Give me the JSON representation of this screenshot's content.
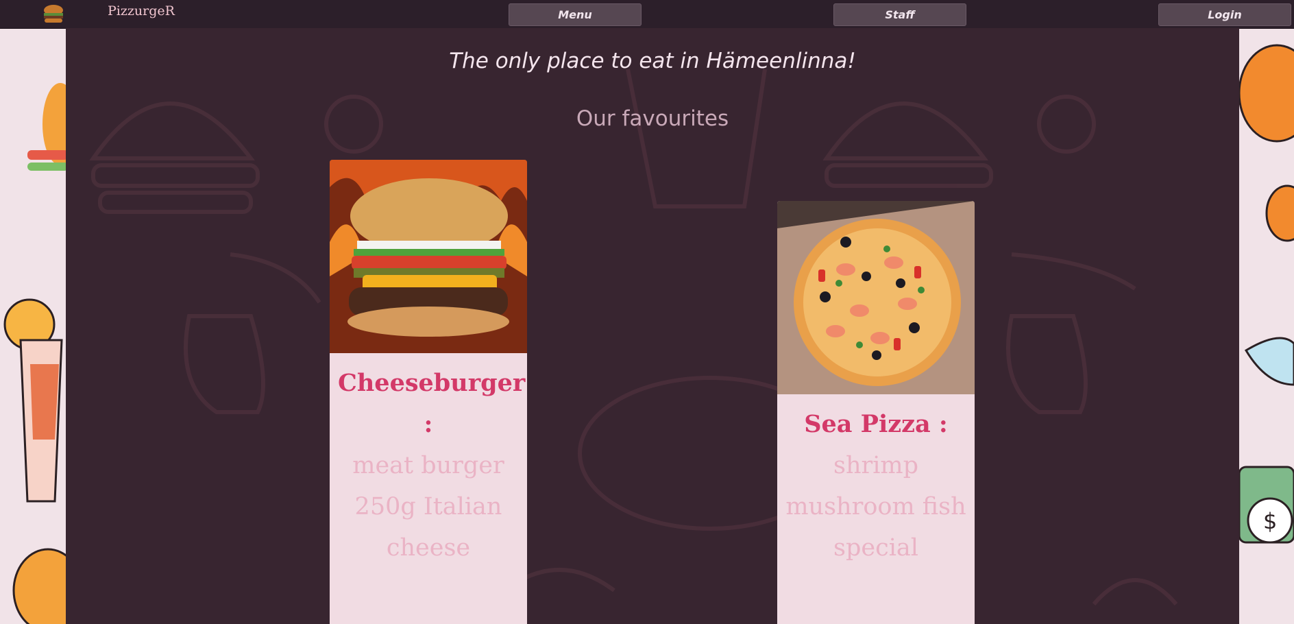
{
  "app": {
    "brand": "PizzurgeR",
    "logo_icon": "burger-logo-icon"
  },
  "nav": {
    "menu_label": "Menu",
    "staff_label": "Staff",
    "login_label": "Login"
  },
  "hero": {
    "tagline": "The only place to eat in Hämeenlinna!",
    "section_title": "Our favourites"
  },
  "favourites": [
    {
      "name": "Cheeseburger :",
      "description": "meat burger 250g Italian cheese",
      "image_icon": "cheeseburger-photo"
    },
    {
      "name": "Sea Pizza :",
      "description": "shrimp mushroom fish special",
      "image_icon": "sea-pizza-photo"
    }
  ],
  "colors": {
    "navbar": "#2c1f2a",
    "main_bg": "#382530",
    "accent": "#d33968",
    "card_bg": "#f1dce3"
  }
}
